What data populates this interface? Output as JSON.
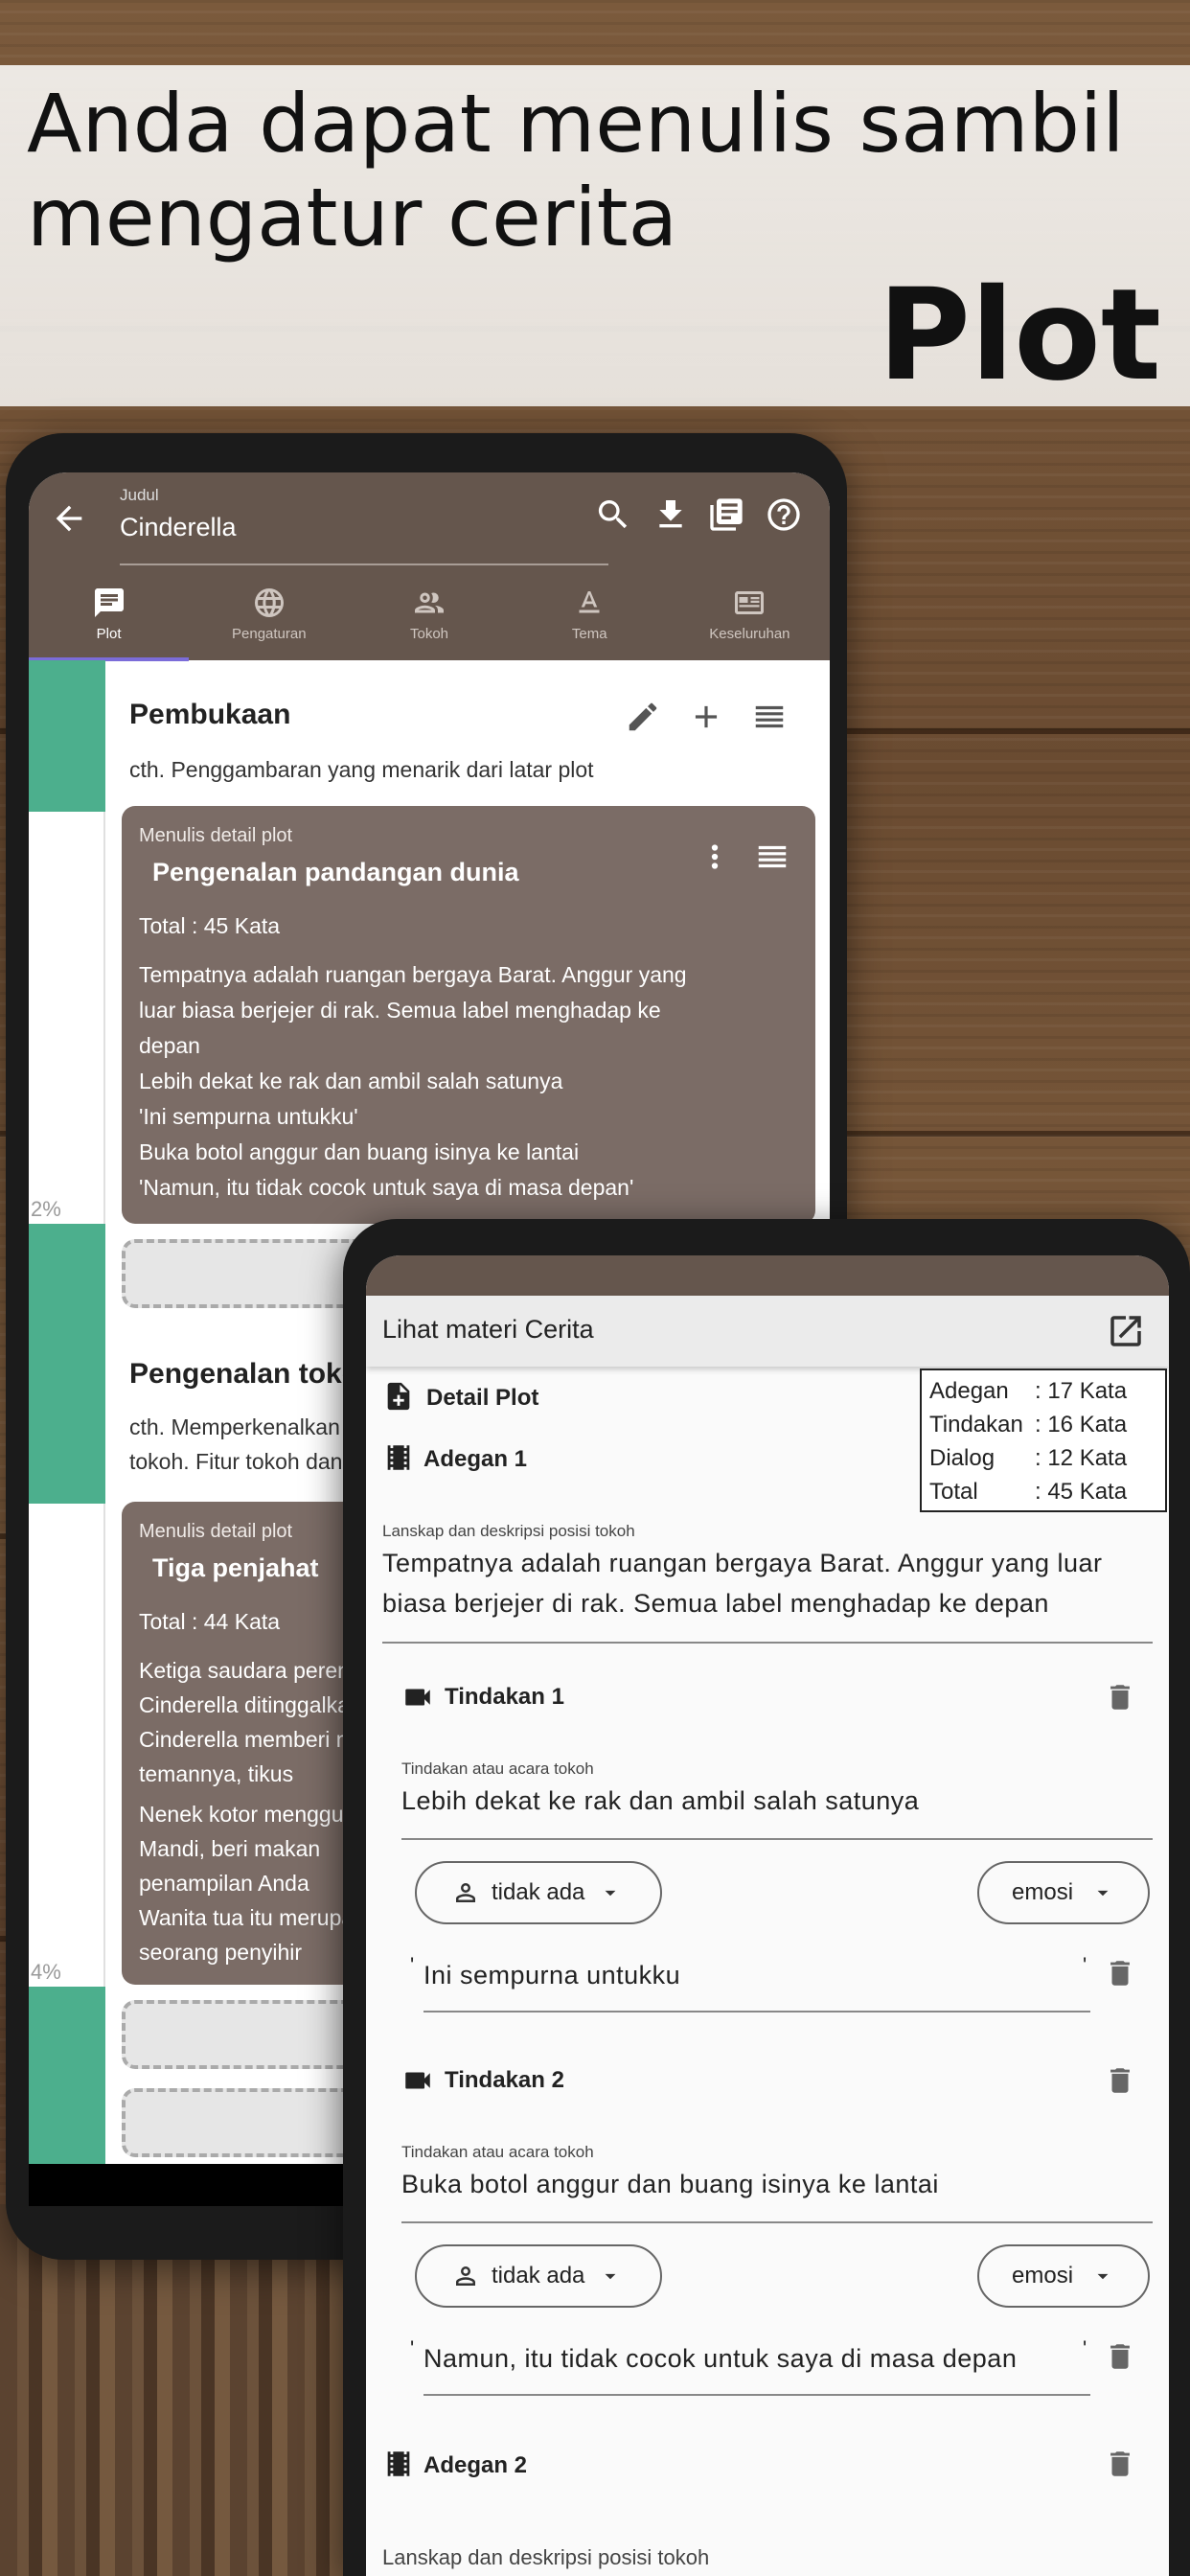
{
  "banner": {
    "headline_line1": "Anda dapat menulis sambil",
    "headline_line2": "mengatur cerita",
    "feature": "Plot"
  },
  "phone1": {
    "appbar": {
      "field_label": "Judul",
      "field_value": "Cinderella",
      "icons": [
        "arrow-back-icon",
        "search-icon",
        "download-icon",
        "library-books-icon",
        "help-icon"
      ]
    },
    "tabs": [
      {
        "label": "Plot",
        "icon": "chat-icon",
        "active": true
      },
      {
        "label": "Pengaturan",
        "icon": "globe-icon",
        "active": false
      },
      {
        "label": "Tokoh",
        "icon": "people-icon",
        "active": false
      },
      {
        "label": "Tema",
        "icon": "text-a-icon",
        "active": false
      },
      {
        "label": "Keseluruhan",
        "icon": "summary-icon",
        "active": false
      }
    ],
    "rail": {
      "pct1": "2%",
      "pct2": "4%"
    },
    "sections": [
      {
        "title": "Pembukaan",
        "desc": "cth. Penggambaran yang menarik dari latar plot",
        "card": {
          "label": "Menulis detail plot",
          "title": "Pengenalan pandangan dunia",
          "total": "Total : 45 Kata",
          "lines": [
            "Tempatnya adalah ruangan bergaya Barat. Anggur yang",
            "luar biasa berjejer di rak. Semua label menghadap ke",
            "depan",
            " Lebih dekat ke rak dan ambil salah satunya",
            " 'Ini sempurna untukku'",
            " Buka botol anggur dan buang isinya ke lantai",
            " 'Namun, itu tidak cocok untuk saya di masa depan'"
          ]
        }
      },
      {
        "title": "Pengenalan tokoh",
        "desc_line1": "cth. Memperkenalkan tokoh utama dan",
        "desc_line2": "tokoh. Fitur tokoh dan",
        "card": {
          "label": "Menulis detail plot",
          "title": "Tiga penjahat",
          "total": "Total : 44 Kata",
          "lines": [
            "Ketiga saudara perempuan",
            "Cinderella ditinggalkan",
            "Cinderella memberi makan",
            "temannya, tikus",
            "Nenek kotor menggunakan",
            "Mandi, beri makan",
            "penampilan Anda",
            "Wanita tua itu merupakan",
            "seorang penyihir"
          ]
        }
      }
    ]
  },
  "phone2": {
    "title": "Lihat materi Cerita",
    "stats": [
      {
        "k": "Adegan",
        "v": ": 17 Kata"
      },
      {
        "k": "Tindakan",
        "v": ": 16 Kata"
      },
      {
        "k": "Dialog",
        "v": ": 12 Kata"
      },
      {
        "k": "Total",
        "v": ": 45 Kata"
      }
    ],
    "detail_plot": "Detail Plot",
    "adegan1": "Adegan 1",
    "landscape_label": "Lanskap dan deskripsi posisi tokoh",
    "landscape_text_line1": "Tempatnya adalah ruangan bergaya Barat. Anggur yang luar",
    "landscape_text_line2": "biasa berjejer di rak. Semua label menghadap ke depan",
    "actions": [
      {
        "title": "Tindakan 1",
        "label": "Tindakan atau acara tokoh",
        "text": "Lebih dekat ke rak dan ambil salah satunya",
        "person": "tidak ada",
        "emotion": "emosi",
        "dialog": "Ini sempurna untukku"
      },
      {
        "title": "Tindakan 2",
        "label": "Tindakan atau acara tokoh",
        "text": "Buka botol anggur dan buang isinya ke lantai",
        "person": "tidak ada",
        "emotion": "emosi",
        "dialog": "Namun, itu tidak cocok untuk saya di masa depan"
      }
    ],
    "adegan2": "Adegan 2",
    "landscape_label2": "Lanskap dan deskripsi posisi tokoh"
  },
  "colors": {
    "appbar": "#65564d",
    "card": "#7b6c66",
    "rail_green": "#4caf8d",
    "tab_indicator": "#7b6cd9"
  }
}
